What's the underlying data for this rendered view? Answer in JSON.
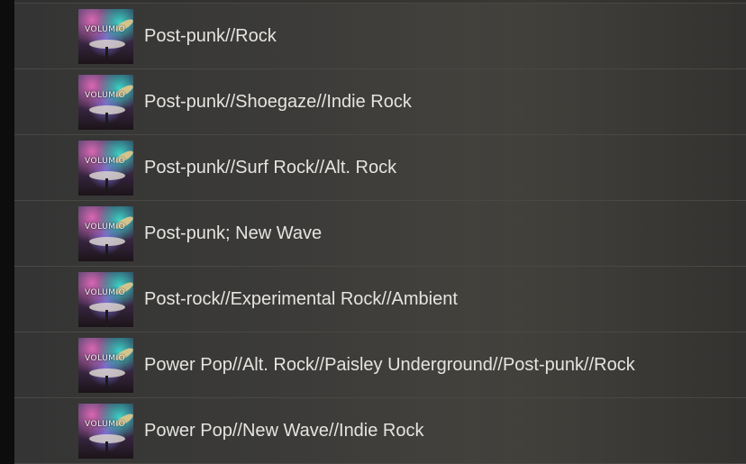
{
  "genres": [
    {
      "label": "Post-punk//Rock",
      "art_icon": "album-art"
    },
    {
      "label": "Post-punk//Shoegaze//Indie Rock",
      "art_icon": "album-art"
    },
    {
      "label": "Post-punk//Surf Rock//Alt. Rock",
      "art_icon": "album-art"
    },
    {
      "label": "Post-punk; New Wave",
      "art_icon": "album-art"
    },
    {
      "label": "Post-rock//Experimental Rock//Ambient",
      "art_icon": "album-art"
    },
    {
      "label": "Power Pop//Alt. Rock//Paisley Underground//Post-punk//Rock",
      "art_icon": "album-art"
    },
    {
      "label": "Power Pop//New Wave//Indie Rock",
      "art_icon": "album-art"
    }
  ],
  "thumbnail_logo": "VOLUMIO"
}
